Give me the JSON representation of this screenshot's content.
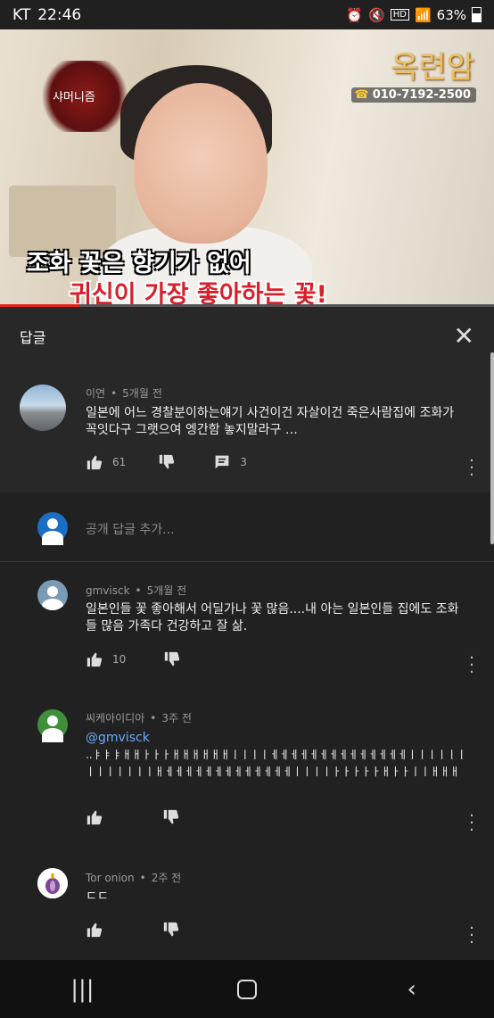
{
  "status": {
    "carrier": "KT",
    "time": "22:46",
    "battery": "63%"
  },
  "video": {
    "logo_text": "샤머니즘",
    "brand": "옥련암",
    "phone": "010-7192-2500",
    "caption_line1": "조화 꽃은 향기가 없어",
    "caption_line2": "귀신이 가장 좋아하는 꽃!",
    "progress": 0.16
  },
  "panel": {
    "title": "답글"
  },
  "main_comment": {
    "author": "이연",
    "time": "5개월 전",
    "text": "일본에 어느 경찰분이하는얘기  사건이건 자살이건 죽은사람집에 조화가 꼭잇다구  그랫으여  엥간함 놓지말라구 …",
    "likes": "61",
    "replies": "3"
  },
  "reply_input": {
    "placeholder": "공개 답글 추가..."
  },
  "replies": [
    {
      "author": "gmvisck",
      "time": "5개월 전",
      "text": "일본인들 꽃 좋아해서 어딜가나 꽃 많음....내 아는 일본인들 집에도 조화들 많음 가족다 건강하고 잘 삶.",
      "likes": "10"
    },
    {
      "author": "씨케아이디아",
      "time": "3주 전",
      "mention": "@gmvisck",
      "text": "..ㅑㅑㅑㅐㅐㅏㅏㅏㅐㅐㅐㅐㅐㅐㅣㅣㅣㅣㅔㅔㅔㅔㅔㅔㅔㅔㅔㅔㅔㅔㅔㅔㅣㅣㅣㅣㅣㅣㅣㅣㅣㅣㅣㅣㅣㅐㅔㅔㅔㅔㅔㅔㅔㅔㅔㅔㅔㅔㅔㅣㅣㅣㅣㅏㅏㅏㅏㅏㅐㅏㅏㅣㅣㅐㅐㅐ",
      "likes": ""
    },
    {
      "author": "Tor onion",
      "time": "2주 전",
      "text": "ㄷㄷ",
      "likes": ""
    }
  ]
}
